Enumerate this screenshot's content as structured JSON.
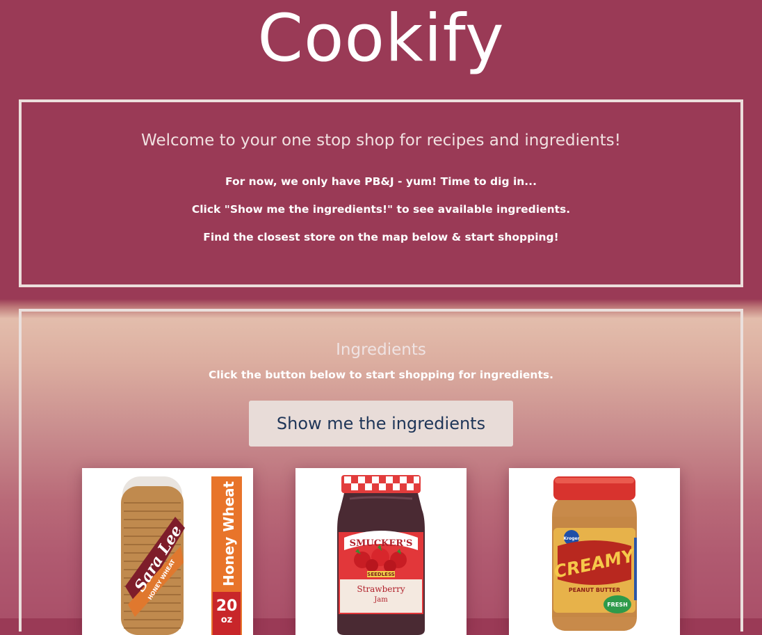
{
  "header": {
    "title": "Cookify"
  },
  "welcome": {
    "heading": "Welcome to your one stop shop for recipes and ingredients!",
    "lines": [
      "For now, we only have PB&J - yum! Time to dig in...",
      "Click \"Show me the ingredients!\" to see available ingredients.",
      "Find the closest store on the map below & start shopping!"
    ]
  },
  "ingredients": {
    "heading": "Ingredients",
    "subtitle": "Click the button below to start shopping for ingredients.",
    "button_label": "Show me the ingredients",
    "products": [
      {
        "name": "bread",
        "brand": "Sara Lee",
        "variant": "HONEY WHEAT",
        "side_label": "Honey Wheat",
        "size": "20",
        "unit": "oz"
      },
      {
        "name": "jam",
        "brand": "SMUCKER'S",
        "tag": "SEEDLESS",
        "flavor": "Strawberry",
        "type": "Jam"
      },
      {
        "name": "peanut-butter",
        "brand": "Kroger",
        "label": "CREAMY",
        "type": "PEANUT BUTTER",
        "badge": "FRESH"
      }
    ]
  },
  "colors": {
    "header_bg": "#9a3a56",
    "box_border": "#ecdfdc",
    "button_bg": "#e8dcd8",
    "button_text": "#1e3558"
  }
}
